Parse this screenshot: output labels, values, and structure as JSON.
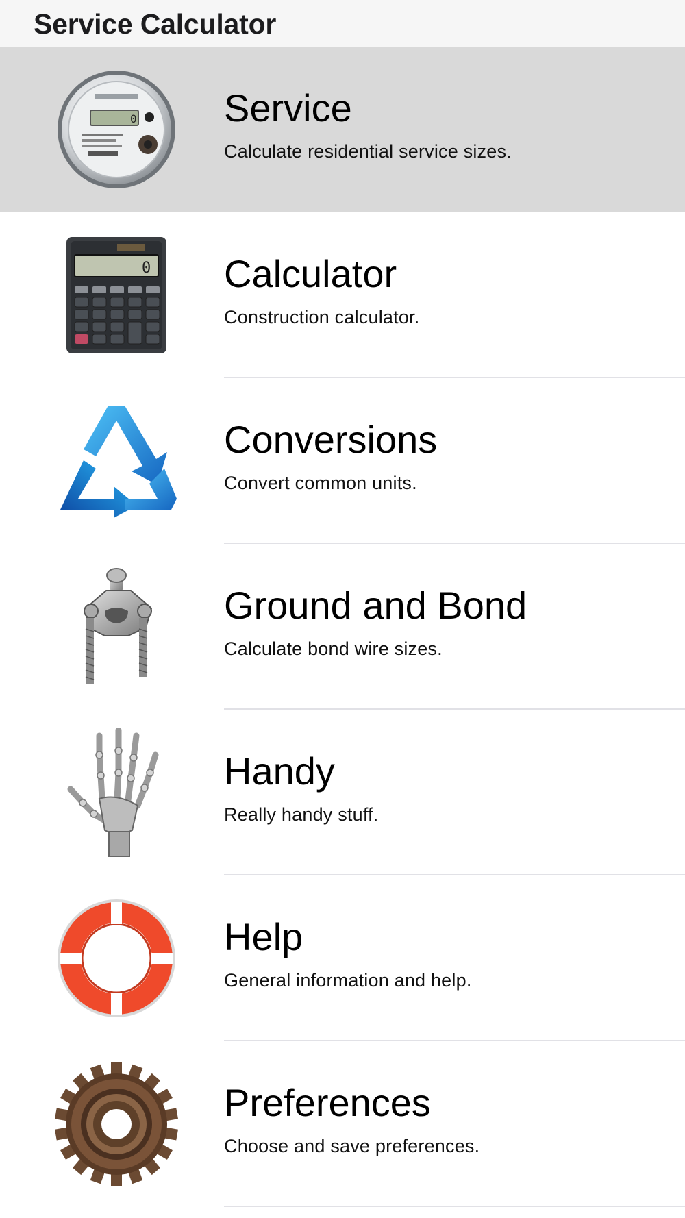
{
  "app": {
    "title": "Service Calculator"
  },
  "menu": {
    "items": [
      {
        "title": "Service",
        "subtitle": "Calculate residential service sizes.",
        "icon": "electric-meter-icon",
        "selected": true
      },
      {
        "title": "Calculator",
        "subtitle": "Construction calculator.",
        "icon": "calculator-icon",
        "selected": false
      },
      {
        "title": "Conversions",
        "subtitle": "Convert common units.",
        "icon": "recycle-triangle-icon",
        "selected": false
      },
      {
        "title": "Ground and Bond",
        "subtitle": "Calculate bond wire sizes.",
        "icon": "ground-clamp-icon",
        "selected": false
      },
      {
        "title": "Handy",
        "subtitle": "Really handy stuff.",
        "icon": "skeleton-hand-icon",
        "selected": false
      },
      {
        "title": "Help",
        "subtitle": "General information and help.",
        "icon": "life-ring-icon",
        "selected": false
      },
      {
        "title": "Preferences",
        "subtitle": "Choose and save preferences.",
        "icon": "gear-cog-icon",
        "selected": false
      }
    ]
  },
  "colors": {
    "nav_background": "#f6f6f6",
    "selected_row": "#d9d9d9",
    "divider": "#e1e1e6",
    "conversions_blue": "#1e88e5",
    "help_orange": "#ef4a2b"
  }
}
